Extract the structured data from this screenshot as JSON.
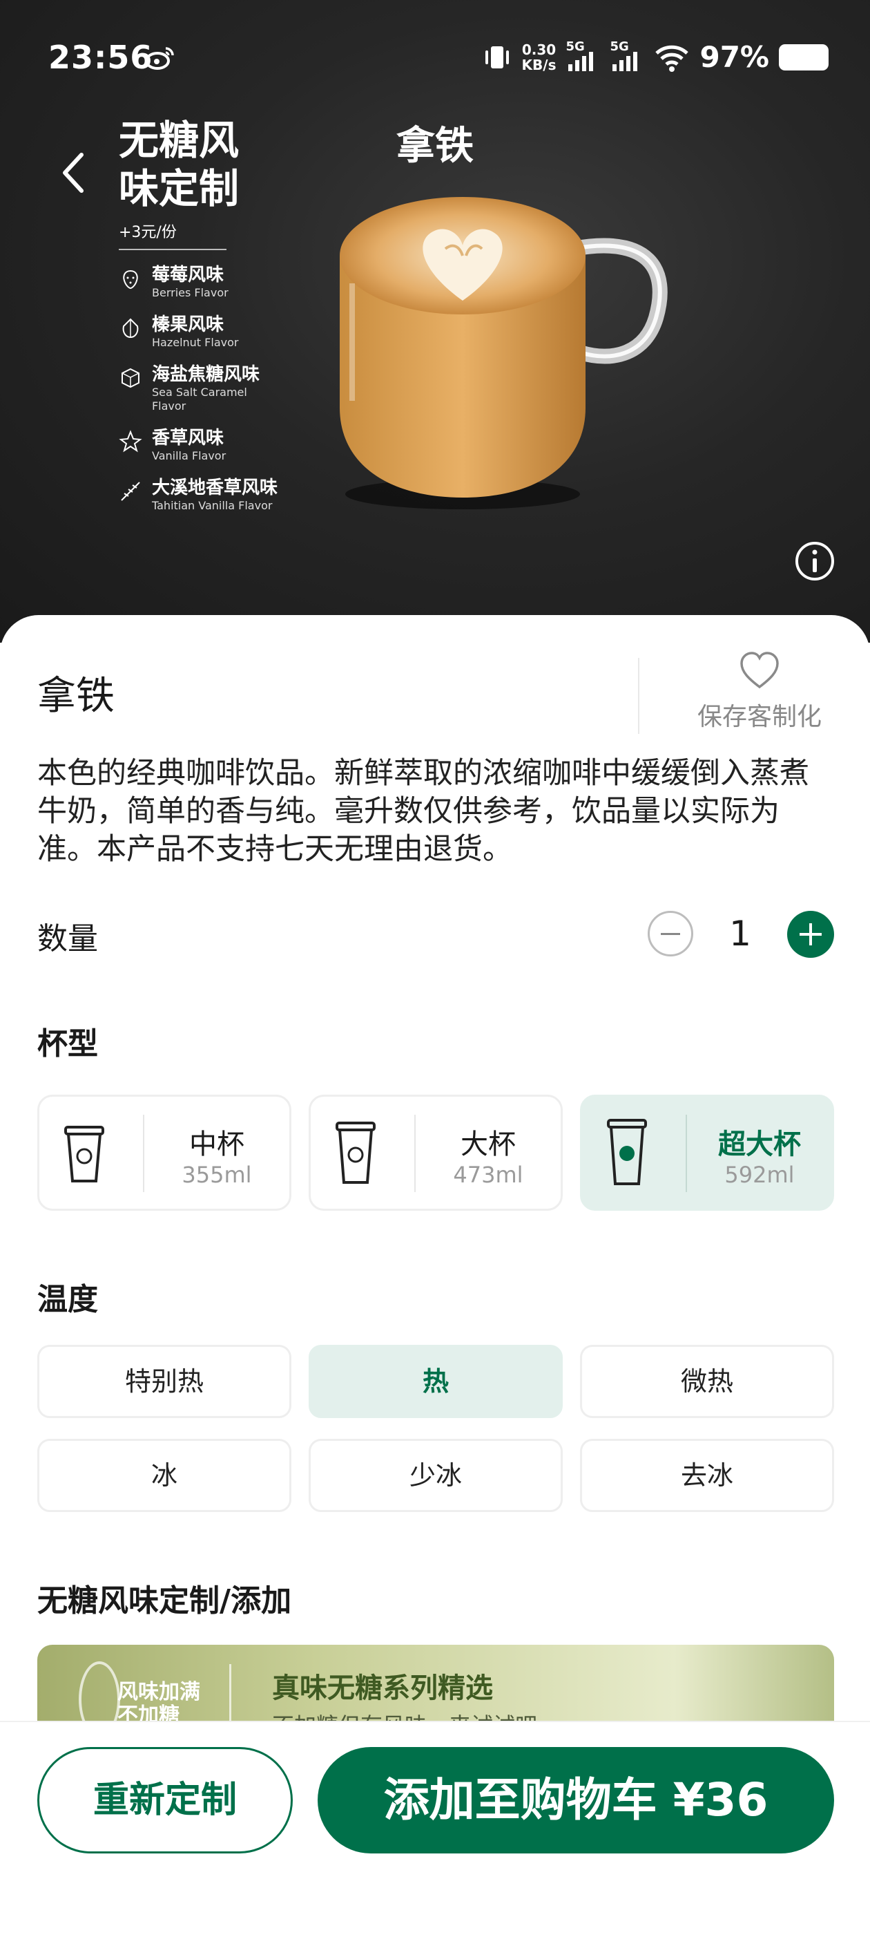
{
  "status_bar": {
    "time": "23:56",
    "speed_value": "0.30",
    "speed_unit": "KB/s",
    "network_1": "5G",
    "network_2": "5G",
    "battery": "97%"
  },
  "header": {
    "title": "拿铁"
  },
  "flavor_panel": {
    "title": "无糖风味定制",
    "price_note": "+3元/份",
    "items": [
      {
        "cn": "莓莓风味",
        "en": "Berries Flavor",
        "icon": "berry-icon"
      },
      {
        "cn": "榛果风味",
        "en": "Hazelnut Flavor",
        "icon": "hazelnut-icon"
      },
      {
        "cn": "海盐焦糖风味",
        "en": "Sea Salt Caramel Flavor",
        "icon": "caramel-icon"
      },
      {
        "cn": "香草风味",
        "en": "Vanilla Flavor",
        "icon": "vanilla-flower-icon"
      },
      {
        "cn": "大溪地香草风味",
        "en": "Tahitian Vanilla Flavor",
        "icon": "vanilla-pod-icon"
      }
    ]
  },
  "product": {
    "name": "拿铁",
    "save_label": "保存客制化",
    "description": "本色的经典咖啡饮品。新鲜萃取的浓缩咖啡中缓缓倒入蒸煮牛奶，简单的香与纯。毫升数仅供参考，饮品量以实际为准。本产品不支持七天无理由退货。"
  },
  "quantity": {
    "label": "数量",
    "value": "1"
  },
  "cup_size": {
    "label": "杯型",
    "options": [
      {
        "name": "中杯",
        "volume": "355ml",
        "selected": false
      },
      {
        "name": "大杯",
        "volume": "473ml",
        "selected": false
      },
      {
        "name": "超大杯",
        "volume": "592ml",
        "selected": true
      }
    ]
  },
  "temperature": {
    "label": "温度",
    "options": [
      {
        "name": "特别热",
        "selected": false
      },
      {
        "name": "热",
        "selected": true
      },
      {
        "name": "微热",
        "selected": false
      },
      {
        "name": "冰",
        "selected": false
      },
      {
        "name": "少冰",
        "selected": false
      },
      {
        "name": "去冰",
        "selected": false
      }
    ]
  },
  "flavor_section": {
    "label": "无糖风味定制/添加",
    "banner_left": "风味加满\n不加糖",
    "banner_title": "真味无糖系列精选",
    "banner_sub": "不加糖但有风味，来试试吧"
  },
  "bottom_bar": {
    "reset_label": "重新定制",
    "cart_label": "添加至购物车 ¥36"
  },
  "colors": {
    "brand_green": "#00704a",
    "selected_bg": "#e3f0ec",
    "hero_bg": "#262626"
  }
}
